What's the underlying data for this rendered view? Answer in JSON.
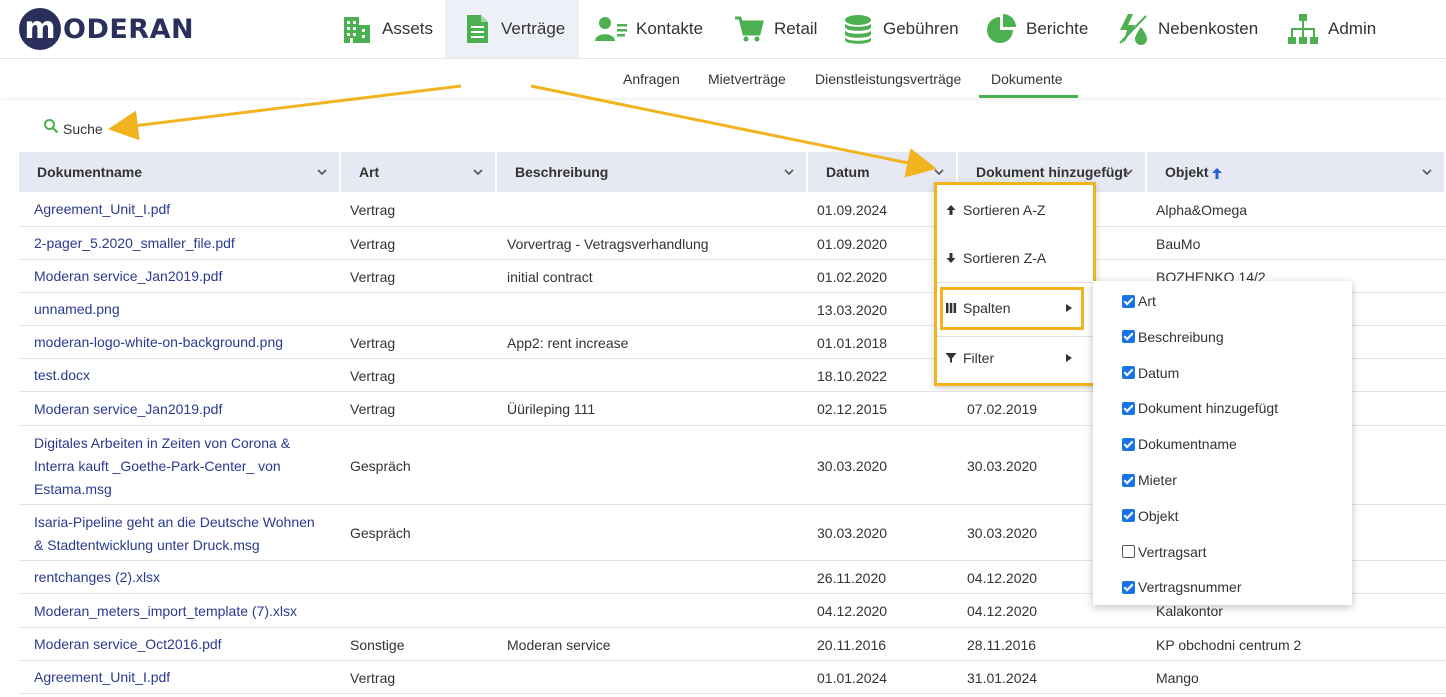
{
  "app": {
    "logo_letter": "m",
    "logo_text": "ODERAN"
  },
  "colors": {
    "brand": "#2b2f5c",
    "accent_green": "#4caf50",
    "link": "#2b3a8f",
    "header_bg": "#e6e9f3",
    "highlight": "#f2b41e",
    "checkbox": "#1a73e8"
  },
  "nav": [
    {
      "label": "Assets",
      "icon": "buildings-icon"
    },
    {
      "label": "Verträge",
      "icon": "document-icon",
      "active": true
    },
    {
      "label": "Kontakte",
      "icon": "contact-card-icon"
    },
    {
      "label": "Retail",
      "icon": "cart-icon"
    },
    {
      "label": "Gebühren",
      "icon": "coins-icon"
    },
    {
      "label": "Berichte",
      "icon": "pie-chart-icon"
    },
    {
      "label": "Nebenkosten",
      "icon": "utilities-icon"
    },
    {
      "label": "Admin",
      "icon": "org-chart-icon"
    }
  ],
  "subnav": [
    {
      "label": "Anfragen"
    },
    {
      "label": "Mietverträge"
    },
    {
      "label": "Dienstleistungsverträge"
    },
    {
      "label": "Dokumente",
      "active": true
    }
  ],
  "search": {
    "label": "Suche"
  },
  "table": {
    "columns": [
      "Dokumentname",
      "Art",
      "Beschreibung",
      "Datum",
      "Dokument hinzugefügt",
      "Objekt"
    ],
    "sorted_column": "Objekt",
    "rows": [
      {
        "name": "Agreement_Unit_I.pdf",
        "art": "Vertrag",
        "beschreibung": "",
        "datum": "01.09.2024",
        "hinzugefuegt": "",
        "objekt": "Alpha&Omega"
      },
      {
        "name": "2-pager_5.2020_smaller_file.pdf",
        "art": "Vertrag",
        "beschreibung": "Vorvertrag - Vetragsverhandlung",
        "datum": "01.09.2020",
        "hinzugefuegt": "",
        "objekt": "BauMo"
      },
      {
        "name": "Moderan service_Jan2019.pdf",
        "art": "Vertrag",
        "beschreibung": "initial contract",
        "datum": "01.02.2020",
        "hinzugefuegt": "",
        "objekt": "BOZHENKO 14/2"
      },
      {
        "name": "unnamed.png",
        "art": "",
        "beschreibung": "",
        "datum": "13.03.2020",
        "hinzugefuegt": "",
        "objekt": ""
      },
      {
        "name": "moderan-logo-white-on-background.png",
        "art": "Vertrag",
        "beschreibung": "App2: rent increase",
        "datum": "01.01.2018",
        "hinzugefuegt": "",
        "objekt": ""
      },
      {
        "name": "test.docx",
        "art": "Vertrag",
        "beschreibung": "",
        "datum": "18.10.2022",
        "hinzugefuegt": "",
        "objekt": ""
      },
      {
        "name": "Moderan service_Jan2019.pdf",
        "art": "Vertrag",
        "beschreibung": "Üürileping 111",
        "datum": "02.12.2015",
        "hinzugefuegt": "07.02.2019",
        "objekt": ""
      },
      {
        "name_lines": [
          "Digitales Arbeiten in Zeiten von Corona &",
          "Interra kauft _Goethe-Park-Center_ von",
          "Estama.msg"
        ],
        "art": "Gespräch",
        "beschreibung": "",
        "datum": "30.03.2020",
        "hinzugefuegt": "30.03.2020",
        "objekt": ""
      },
      {
        "name_lines": [
          "Isaria-Pipeline geht an die Deutsche Wohnen",
          "& Stadtentwicklung unter Druck.msg"
        ],
        "art": "Gespräch",
        "beschreibung": "",
        "datum": "30.03.2020",
        "hinzugefuegt": "30.03.2020",
        "objekt": ""
      },
      {
        "name": "rentchanges (2).xlsx",
        "art": "",
        "beschreibung": "",
        "datum": "26.11.2020",
        "hinzugefuegt": "04.12.2020",
        "objekt": ""
      },
      {
        "name": "Moderan_meters_import_template (7).xlsx",
        "art": "",
        "beschreibung": "",
        "datum": "04.12.2020",
        "hinzugefuegt": "04.12.2020",
        "objekt": "Kalakontor"
      },
      {
        "name": "Moderan service_Oct2016.pdf",
        "art": "Sonstige",
        "beschreibung": "Moderan service",
        "datum": "20.11.2016",
        "hinzugefuegt": "28.11.2016",
        "objekt": "KP obchodni centrum 2"
      },
      {
        "name": "Agreement_Unit_I.pdf",
        "art": "Vertrag",
        "beschreibung": "",
        "datum": "01.01.2024",
        "hinzugefuegt": "31.01.2024",
        "objekt": "Mango"
      }
    ]
  },
  "column_menu": {
    "sort_asc": "Sortieren A-Z",
    "sort_desc": "Sortieren Z-A",
    "columns": "Spalten",
    "filter": "Filter"
  },
  "columns_submenu": [
    {
      "label": "Art",
      "checked": true
    },
    {
      "label": "Beschreibung",
      "checked": true
    },
    {
      "label": "Datum",
      "checked": true
    },
    {
      "label": "Dokument hinzugefügt",
      "checked": true
    },
    {
      "label": "Dokumentname",
      "checked": true
    },
    {
      "label": "Mieter",
      "checked": true
    },
    {
      "label": "Objekt",
      "checked": true
    },
    {
      "label": "Vertragsart",
      "checked": false
    },
    {
      "label": "Vertragsnummer",
      "checked": true
    }
  ]
}
